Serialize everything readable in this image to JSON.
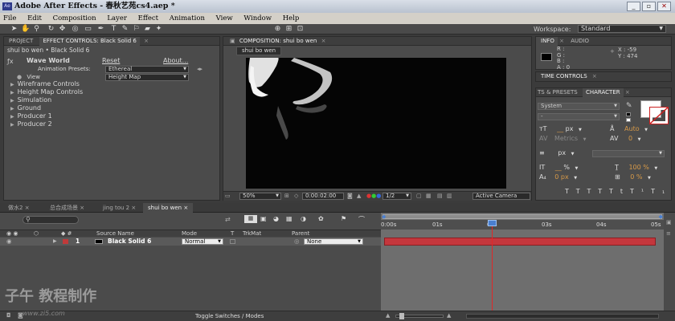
{
  "window": {
    "title": "Adobe After Effects - 春秋艺苑cs4.aep *",
    "icon_text": "Ae",
    "min": "_",
    "max": "▫",
    "close": "✕"
  },
  "menu": [
    "File",
    "Edit",
    "Composition",
    "Layer",
    "Effect",
    "Animation",
    "View",
    "Window",
    "Help"
  ],
  "toolbar": {
    "workspace_label": "Workspace:",
    "workspace_value": "Standard"
  },
  "project_panel": {
    "tab_project": "PROJECT",
    "tab_effect": "EFFECT CONTROLS: Black Solid 6",
    "breadcrumb": "shui bo wen • Black Solid 6"
  },
  "effect": {
    "name": "Wave World",
    "reset": "Reset",
    "about": "About...",
    "presets_label": "Animation Presets:",
    "presets_value": "Ethereal",
    "view_label": "View",
    "view_value": "Height Map",
    "groups": [
      "Wireframe Controls",
      "Height Map Controls",
      "Simulation",
      "Ground",
      "Producer 1",
      "Producer 2"
    ]
  },
  "comp_panel": {
    "tab": "COMPOSITION: shui bo wen",
    "comp_tab": "shui bo wen",
    "zoom": "50%",
    "timecode": "0:00:02:00",
    "resolution": "1/2",
    "camera": "Active Camera"
  },
  "info_panel": {
    "tab_info": "INFO",
    "tab_audio": "AUDIO",
    "r": "R :",
    "g": "G :",
    "b": "B :",
    "a": "A : 0",
    "x": "X : -59",
    "y": "Y : 474"
  },
  "time_controls": {
    "tab": "TIME CONTROLS"
  },
  "character": {
    "tab_presets": "TS & PRESETS",
    "tab_character": "CHARACTER",
    "font": "System",
    "style": "-",
    "size_unit": "px",
    "leading": "Auto",
    "kerning": "Metrics",
    "tracking": "0",
    "stroke_unit": "px",
    "vscale": "%",
    "hscale": "100 %",
    "baseline": "0 px",
    "tsume": "0 %"
  },
  "timeline": {
    "tabs": [
      "做水2",
      "总合成场景",
      "jing tou 2",
      "shui bo wen"
    ],
    "search_placeholder": "",
    "col_source": "Source Name",
    "col_mode": "Mode",
    "col_t": "T",
    "col_trkmat": "TrkMat",
    "col_parent": "Parent",
    "ruler": [
      "0:00s",
      "01s",
      "02s",
      "03s",
      "04s",
      "05s"
    ],
    "layer": {
      "num": "1",
      "name": "Black Solid 6",
      "mode": "Normal",
      "parent": "None"
    },
    "footer": "Toggle Switches / Modes"
  },
  "watermark": {
    "text": "子午 教程制作",
    "url": "www.zi5.com"
  },
  "colors": {
    "layer_bar": "#c4373d",
    "cti": "#e02828",
    "layer_label": "#c03a3a"
  }
}
